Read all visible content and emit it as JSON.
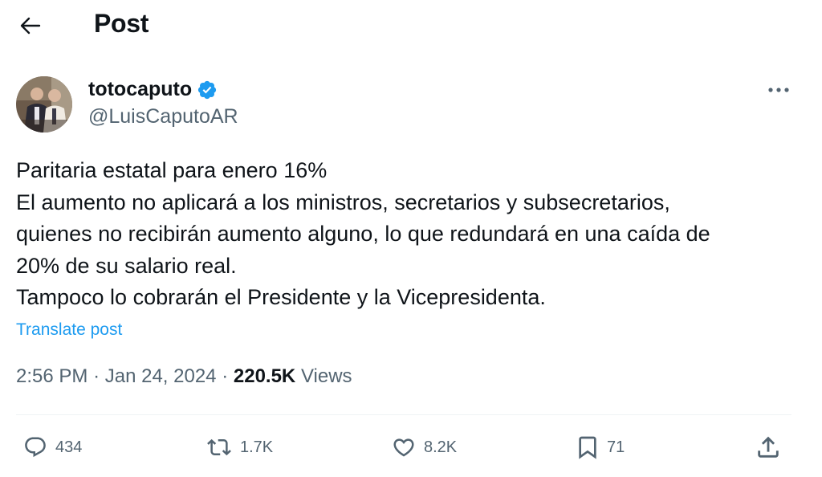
{
  "header": {
    "title": "Post"
  },
  "author": {
    "name": "totocaputo",
    "handle": "@LuisCaputoAR",
    "verified": true
  },
  "post": {
    "lines": [
      "Paritaria estatal para enero 16%",
      "El aumento no aplicará a los ministros, secretarios y subsecretarios,",
      "quienes no recibirán aumento alguno, lo que redundará en una caída de",
      "20% de su salario real.",
      "Tampoco lo cobrarán el Presidente y la Vicepresidenta."
    ],
    "translate_label": "Translate post"
  },
  "meta": {
    "time": "2:56 PM",
    "separator": "·",
    "date": "Jan 24, 2024",
    "views_count": "220.5K",
    "views_label": "Views"
  },
  "actions": {
    "replies": "434",
    "reposts": "1.7K",
    "likes": "8.2K",
    "bookmarks": "71"
  },
  "colors": {
    "text": "#0f1419",
    "secondary": "#536471",
    "link": "#1d9bf0",
    "verified_badge": "#1d9bf0",
    "divider": "#eff3f4"
  },
  "icons": {
    "back": "arrow-left-icon",
    "verified": "verified-badge-icon",
    "more": "more-horizontal-icon",
    "reply": "reply-icon",
    "repost": "repost-icon",
    "like": "heart-icon",
    "bookmark": "bookmark-icon",
    "share": "share-icon"
  }
}
